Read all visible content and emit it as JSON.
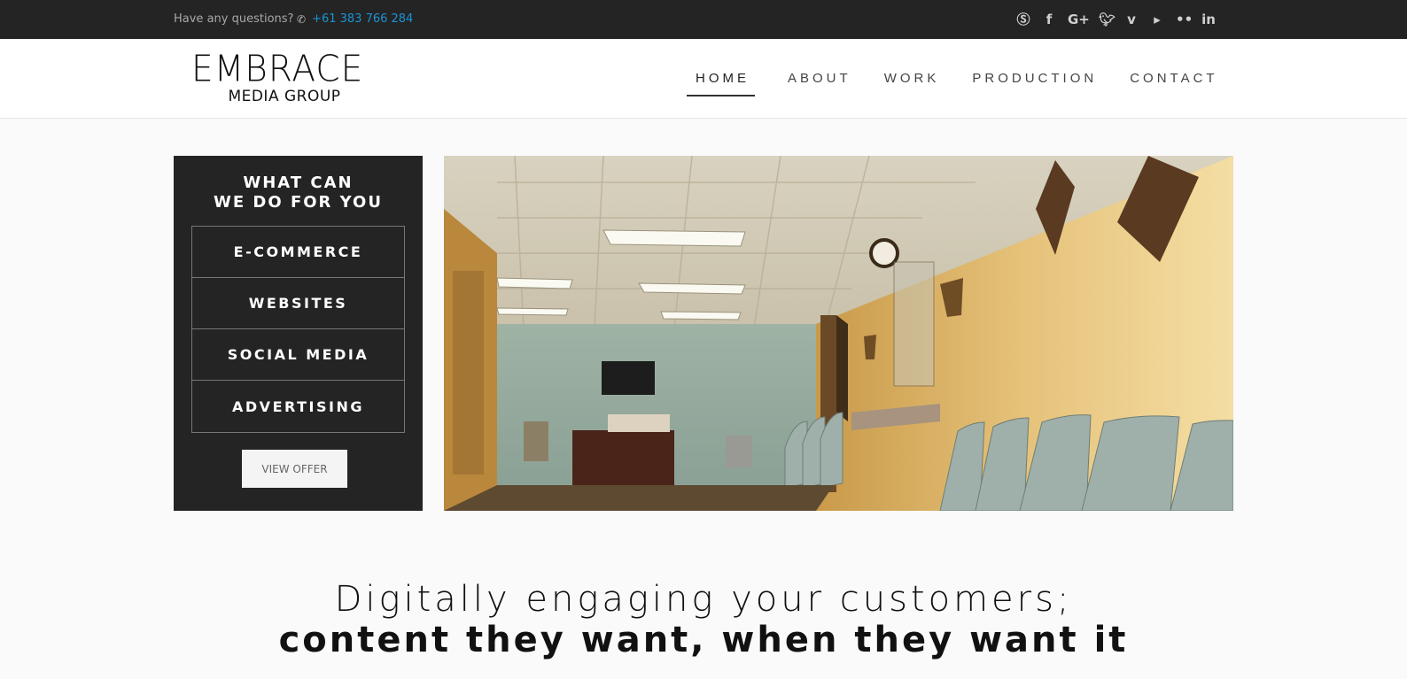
{
  "topbar": {
    "question": "Have any questions?",
    "phone": "+61 383 766 284",
    "social_icons": [
      "skype-icon",
      "facebook-icon",
      "google-plus-icon",
      "twitter-icon",
      "vimeo-icon",
      "youtube-icon",
      "flickr-icon",
      "linkedin-icon"
    ]
  },
  "logo": {
    "main": "EMBRACE",
    "sub": "MEDIA GROUP"
  },
  "nav": {
    "items": [
      "HOME",
      "ABOUT",
      "WORK",
      "PRODUCTION",
      "CONTACT"
    ],
    "active": "HOME"
  },
  "sidebar": {
    "title_line1": "WHAT CAN",
    "title_line2": "WE DO FOR YOU",
    "items": [
      "E-COMMERCE",
      "WEBSITES",
      "SOCIAL MEDIA",
      "ADVERTISING"
    ],
    "offer_button": "VIEW OFFER"
  },
  "headline": {
    "line1": "Digitally engaging your customers;",
    "line2": "content they want, when they want it"
  },
  "colors": {
    "topbar_bg": "#242424",
    "phone_link": "#1a93d4",
    "sidebar_bg": "#242424",
    "page_bg": "#fafafa"
  }
}
